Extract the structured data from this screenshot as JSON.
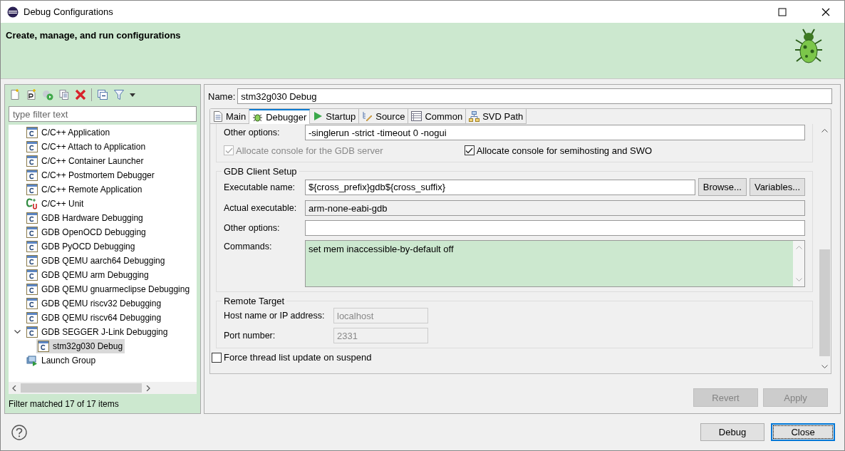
{
  "window": {
    "title": "Debug Configurations"
  },
  "banner": {
    "title": "Create, manage, and run configurations"
  },
  "filter": {
    "placeholder": "type filter text"
  },
  "tree": [
    {
      "label": "C/C++ Application",
      "kind": "config",
      "selected": false
    },
    {
      "label": "C/C++ Attach to Application",
      "kind": "config",
      "selected": false
    },
    {
      "label": "C/C++ Container Launcher",
      "kind": "config",
      "selected": false
    },
    {
      "label": "C/C++ Postmortem Debugger",
      "kind": "config",
      "selected": false
    },
    {
      "label": "C/C++ Remote Application",
      "kind": "config",
      "selected": false
    },
    {
      "label": "C/C++ Unit",
      "kind": "unit",
      "selected": false
    },
    {
      "label": "GDB Hardware Debugging",
      "kind": "config",
      "selected": false
    },
    {
      "label": "GDB OpenOCD Debugging",
      "kind": "config",
      "selected": false
    },
    {
      "label": "GDB PyOCD Debugging",
      "kind": "config",
      "selected": false
    },
    {
      "label": "GDB QEMU aarch64 Debugging",
      "kind": "config",
      "selected": false
    },
    {
      "label": "GDB QEMU arm Debugging",
      "kind": "config",
      "selected": false
    },
    {
      "label": "GDB QEMU gnuarmeclipse Debugging",
      "kind": "config",
      "selected": false
    },
    {
      "label": "GDB QEMU riscv32 Debugging",
      "kind": "config",
      "selected": false
    },
    {
      "label": "GDB QEMU riscv64 Debugging",
      "kind": "config",
      "selected": false
    },
    {
      "label": "GDB SEGGER J-Link Debugging",
      "kind": "config",
      "selected": false,
      "expanded": true,
      "children": [
        {
          "label": "stm32g030 Debug",
          "kind": "config",
          "selected": true
        }
      ]
    },
    {
      "label": "Launch Group",
      "kind": "group",
      "selected": false
    }
  ],
  "filter_status": "Filter matched 17 of 17 items",
  "name": {
    "label": "Name:",
    "value": "stm32g030 Debug"
  },
  "tabs": [
    {
      "label": "Main",
      "kind": "doc",
      "selected": false
    },
    {
      "label": "Debugger",
      "kind": "bug",
      "selected": true
    },
    {
      "label": "Startup",
      "kind": "play",
      "selected": false
    },
    {
      "label": "Source",
      "kind": "source",
      "selected": false
    },
    {
      "label": "Common",
      "kind": "table",
      "selected": false
    },
    {
      "label": "SVD Path",
      "kind": "tree",
      "selected": false
    }
  ],
  "server_section": {
    "other": {
      "label": "Other options:",
      "value": "-singlerun -strict -timeout 0 -nogui"
    },
    "checkboxes": [
      {
        "label": "Allocate console for the GDB server",
        "checked": true,
        "disabled": true
      },
      {
        "label": "Allocate console for semihosting and SWO",
        "checked": true,
        "disabled": false
      }
    ]
  },
  "client_section": {
    "title": "GDB Client Setup",
    "executable": {
      "label": "Executable name:",
      "value": "${cross_prefix}gdb${cross_suffix}",
      "buttons": [
        "Browse...",
        "Variables..."
      ]
    },
    "actual": {
      "label": "Actual executable:",
      "value": "arm-none-eabi-gdb"
    },
    "other": {
      "label": "Other options:"
    },
    "commands": {
      "label": "Commands:",
      "value": "set mem inaccessible-by-default off"
    }
  },
  "remote_section": {
    "title": "Remote Target",
    "rows": [
      {
        "label": "Host name or IP address:",
        "value": "localhost",
        "disabled": true
      },
      {
        "label": "Port number:",
        "value": "2331",
        "disabled": true
      }
    ]
  },
  "force_thread": {
    "label": "Force thread list update on suspend",
    "checked": false
  },
  "actions": [
    {
      "label": "Revert",
      "disabled": true
    },
    {
      "label": "Apply",
      "disabled": true
    }
  ],
  "footer_buttons": [
    {
      "label": "Debug",
      "default": false
    },
    {
      "label": "Close",
      "default": true
    }
  ]
}
